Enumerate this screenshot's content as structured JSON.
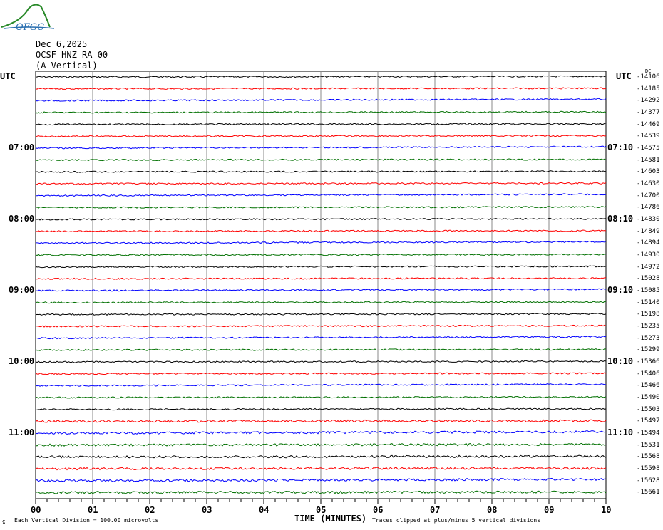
{
  "header": {
    "logo_text": "OFGC",
    "date": "Dec 6,2025",
    "station": "OCSF HNZ RA 00",
    "component": "(A Vertical)"
  },
  "left_utc_label": "UTC",
  "right_utc_label": "UTC",
  "dc_label": "DC",
  "footer": {
    "scale": "Each Vertical Division =  100.00 microvolts",
    "clip_note": "Traces clipped at plus/minus 5 vertical divisions",
    "corner_mark": "ƛ"
  },
  "chart_data": {
    "type": "line",
    "title": "Helicorder OCSF HNZ RA 00",
    "xlabel": "TIME (MINUTES)",
    "x_ticks": [
      "00",
      "01",
      "02",
      "03",
      "04",
      "05",
      "06",
      "07",
      "08",
      "09",
      "10"
    ],
    "xlim": [
      0,
      10
    ],
    "left_hour_labels": [
      {
        "row": 6,
        "label": "07:00"
      },
      {
        "row": 12,
        "label": "08:00"
      },
      {
        "row": 18,
        "label": "09:00"
      },
      {
        "row": 24,
        "label": "10:00"
      },
      {
        "row": 30,
        "label": "11:00"
      }
    ],
    "right_hour_labels": [
      {
        "row": 6,
        "label": "07:10"
      },
      {
        "row": 12,
        "label": "08:10"
      },
      {
        "row": 18,
        "label": "09:10"
      },
      {
        "row": 24,
        "label": "10:10"
      },
      {
        "row": 30,
        "label": "11:10"
      }
    ],
    "trace_colors": [
      "#000000",
      "#ff0000",
      "#0000ff",
      "#007000"
    ],
    "dc_offsets": [
      -14106,
      -14185,
      -14292,
      -14377,
      -14469,
      -14539,
      -14575,
      -14581,
      -14603,
      -14630,
      -14700,
      -14786,
      -14830,
      -14849,
      -14894,
      -14930,
      -14972,
      -15028,
      -15085,
      -15140,
      -15198,
      -15235,
      -15273,
      -15299,
      -15366,
      -15406,
      -15466,
      -15490,
      -15503,
      -15497,
      -15494,
      -15531,
      -15568,
      -15598,
      -15628,
      -15661
    ],
    "trace_count": 36,
    "minutes_per_trace": 10
  }
}
